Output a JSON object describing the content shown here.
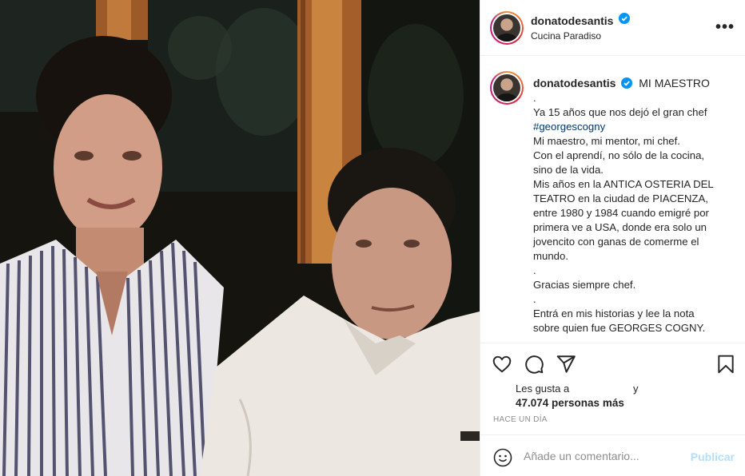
{
  "post": {
    "image_alt": "Two men posing together, vintage photograph"
  },
  "header": {
    "username": "donatodesantis",
    "location": "Cucina Paradiso",
    "more_label": "•••"
  },
  "caption": {
    "username": "donatodesantis",
    "title": "MI MAESTRO",
    "lines": [
      ".",
      "Ya 15 años que nos dejó el gran chef",
      "#georgescogny",
      "Mi maestro, mi mentor, mi chef.",
      "Con el aprendí, no sólo de la cocina,",
      "sino de la vida.",
      "Mis años en la ANTICA OSTERIA DEL",
      "TEATRO en la ciudad de PIACENZA,",
      "entre 1980 y 1984 cuando emigré por",
      "primera ve a USA, donde era solo un",
      "jovencito con ganas de comerme el",
      "mundo.",
      ".",
      "Gracias siempre chef.",
      ".",
      "Entrá en mis historias y lee la nota",
      "sobre quien fue GEORGES COGNY."
    ]
  },
  "likes": {
    "prefix": "Les gusta a",
    "conj": "y",
    "count_text": "47.074 personas más"
  },
  "time_ago": "HACE UN DÍA",
  "comment": {
    "placeholder": "Añade un comentario...",
    "publish_label": "Publicar"
  },
  "colors": {
    "verified": "#0095f6",
    "publish_disabled": "#b2dffc",
    "hashtag": "#00376b"
  },
  "icons": [
    "heart-icon",
    "comment-icon",
    "share-icon",
    "bookmark-icon",
    "emoji-icon",
    "verified-icon",
    "more-icon"
  ]
}
